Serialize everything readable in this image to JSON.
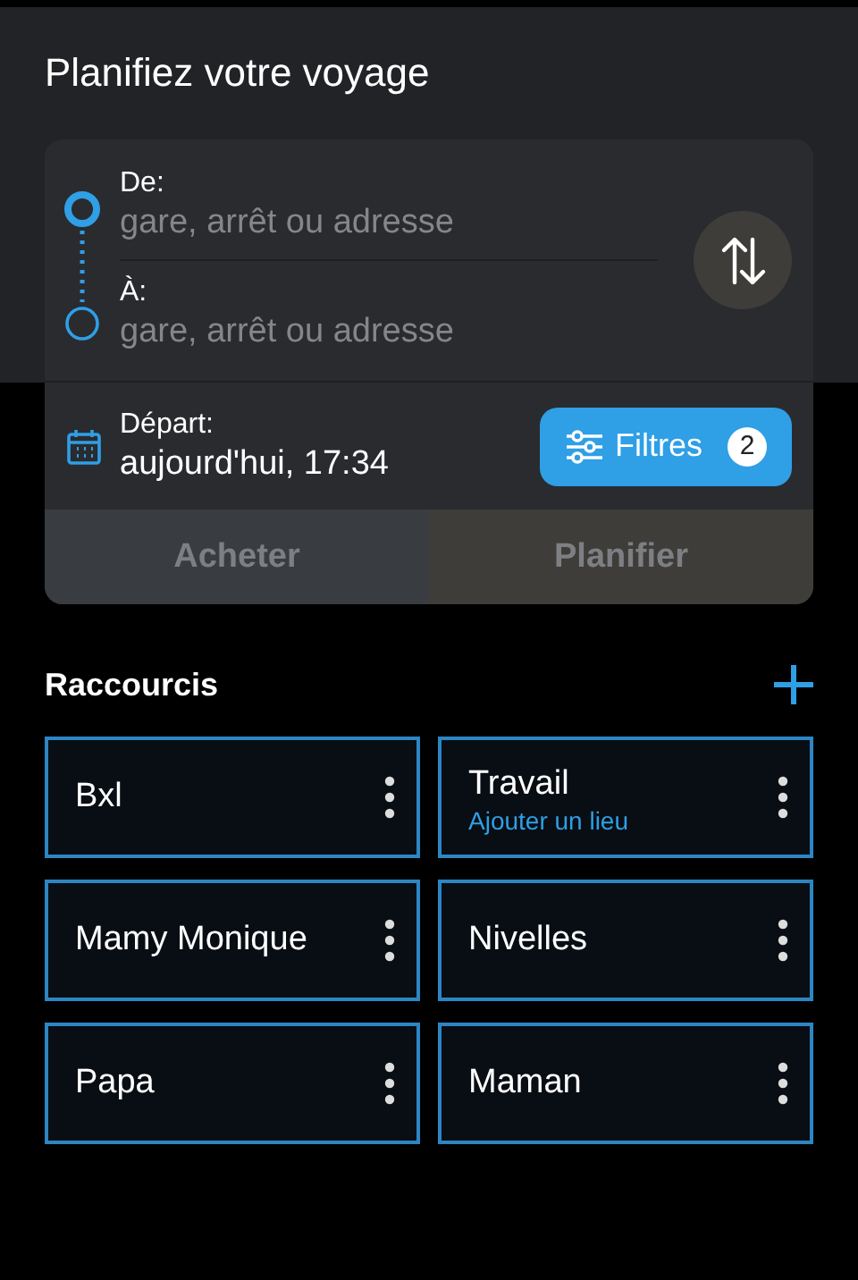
{
  "title": "Planifiez votre voyage",
  "route": {
    "stops": [
      {
        "label": "De:",
        "placeholder": "gare, arrêt ou adresse",
        "active": true
      },
      {
        "label": "À:",
        "placeholder": "gare, arrêt ou adresse",
        "active": false
      }
    ]
  },
  "departure": {
    "label": "Départ:",
    "value": "aujourd'hui, 17:34"
  },
  "filters": {
    "label": "Filtres",
    "count": "2"
  },
  "actions": [
    {
      "label": "Acheter",
      "kind": "buy",
      "disabled": true
    },
    {
      "label": "Planifier",
      "kind": "plan",
      "disabled": true
    }
  ],
  "shortcuts": {
    "title": "Raccourcis",
    "items": [
      {
        "name": "Bxl"
      },
      {
        "name": "Travail",
        "subtitle": "Ajouter un lieu"
      },
      {
        "name": "Mamy Monique"
      },
      {
        "name": "Nivelles"
      },
      {
        "name": "Papa"
      },
      {
        "name": "Maman"
      }
    ]
  }
}
